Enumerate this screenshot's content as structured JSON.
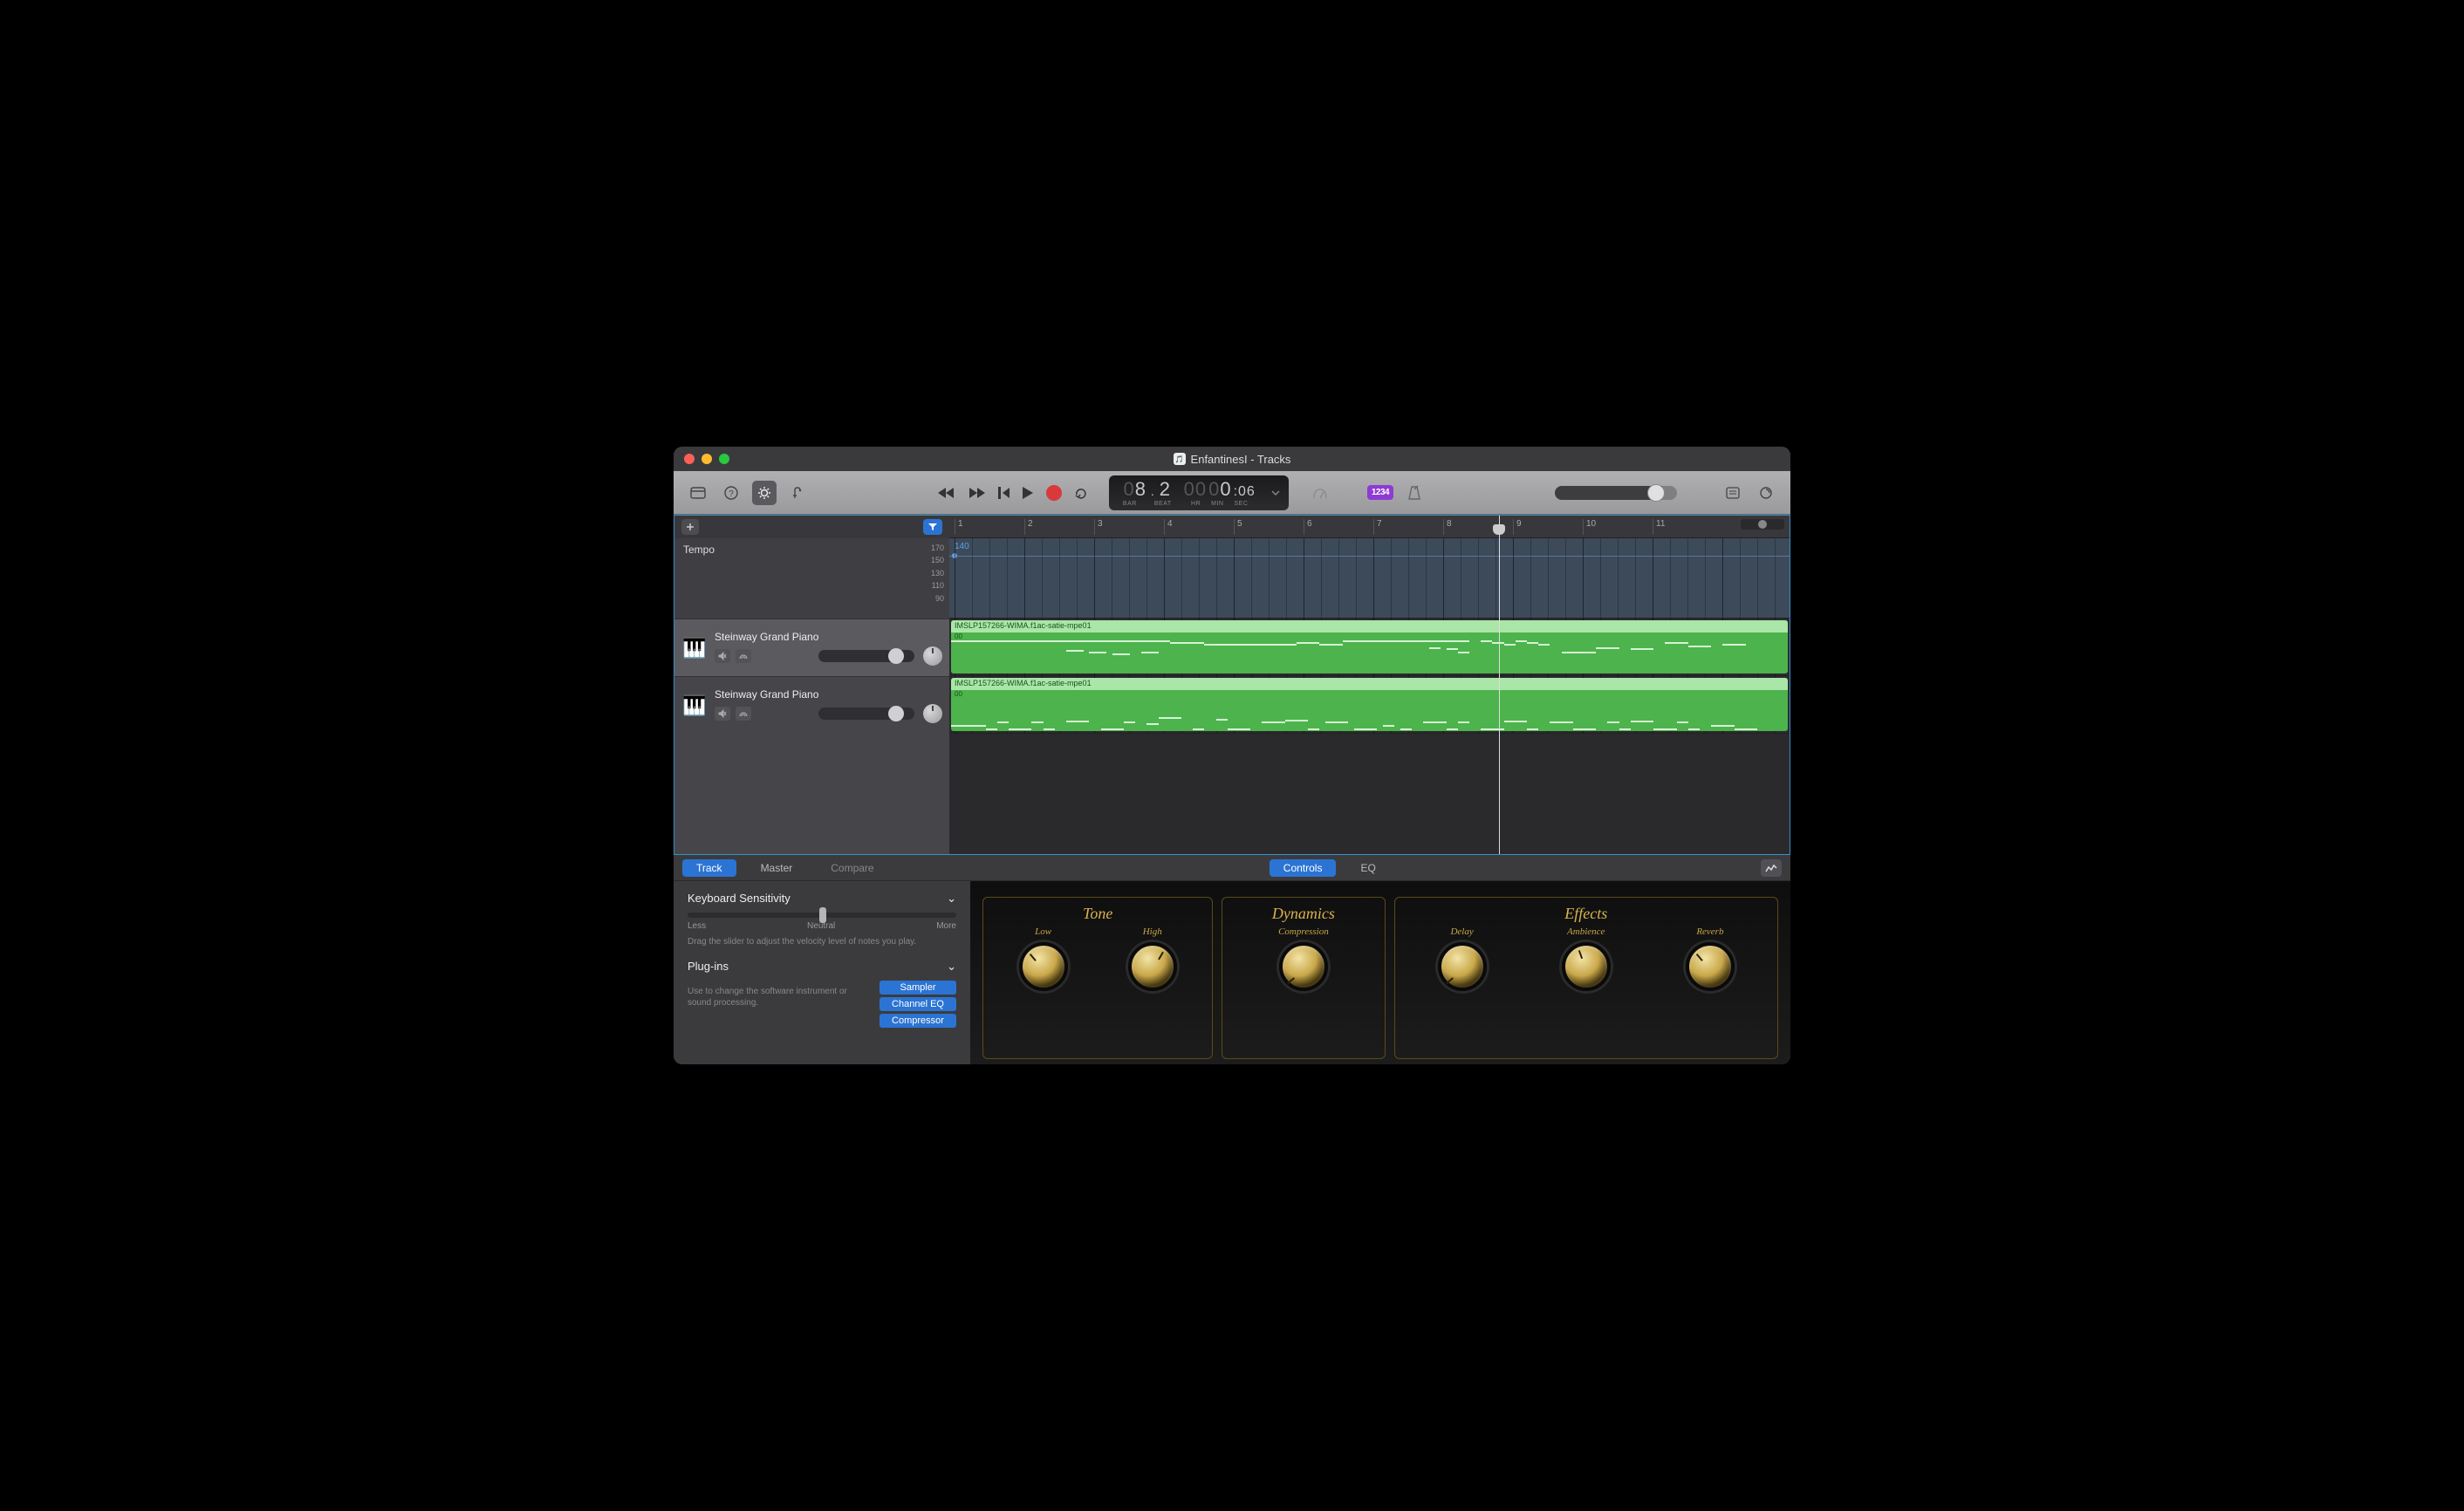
{
  "window": {
    "title": "EnfantinesI - Tracks"
  },
  "toolbar": {
    "count_in_badge": "1234"
  },
  "lcd": {
    "bar": "08.2",
    "bar_label": "BAR",
    "beat_label": "BEAT",
    "hr": "00",
    "min": "00",
    "sec": ":06",
    "hr_label": "HR",
    "min_label": "MIN",
    "sec_label": "SEC"
  },
  "ruler": {
    "bars": [
      1,
      2,
      3,
      4,
      5,
      6,
      7,
      8,
      9,
      10,
      11
    ],
    "playhead_bar": 8.8
  },
  "sidebar": {
    "tempo_label": "Tempo",
    "tempo_scale": [
      "170",
      "150",
      "130",
      "110",
      "90"
    ],
    "tempo_value": "140"
  },
  "tracks": [
    {
      "name": "Steinway Grand Piano",
      "selected": true
    },
    {
      "name": "Steinway Grand Piano",
      "selected": false
    }
  ],
  "regions": [
    {
      "title": "IMSLP157266-WIMA.f1ac-satie-mpe01",
      "sub": "00"
    },
    {
      "title": "IMSLP157266-WIMA.f1ac-satie-mpe01",
      "sub": "00"
    }
  ],
  "panel": {
    "tabs_left": {
      "track": "Track",
      "master": "Master",
      "compare": "Compare"
    },
    "tabs_center": {
      "controls": "Controls",
      "eq": "EQ"
    },
    "keyboard_sensitivity": {
      "title": "Keyboard Sensitivity",
      "less": "Less",
      "neutral": "Neutral",
      "more": "More",
      "help": "Drag the slider to adjust the velocity level of notes you play."
    },
    "plugins": {
      "title": "Plug-ins",
      "help": "Use to change the software instrument or sound processing.",
      "items": [
        "Sampler",
        "Channel EQ",
        "Compressor"
      ]
    }
  },
  "instrument": {
    "tone": {
      "title": "Tone",
      "labels": [
        "Low",
        "High"
      ]
    },
    "dynamics": {
      "title": "Dynamics",
      "labels": [
        "Compression"
      ]
    },
    "effects": {
      "title": "Effects",
      "labels": [
        "Delay",
        "Ambience",
        "Reverb"
      ]
    }
  },
  "midi_notes_a": [
    [
      0,
      74,
      10
    ],
    [
      6,
      74,
      32
    ],
    [
      38,
      72,
      6
    ],
    [
      20,
      62,
      3
    ],
    [
      24,
      60,
      3
    ],
    [
      28,
      58,
      3
    ],
    [
      33,
      60,
      3
    ],
    [
      44,
      70,
      16
    ],
    [
      60,
      72,
      4
    ],
    [
      64,
      70,
      4
    ],
    [
      68,
      74,
      22
    ],
    [
      83,
      66,
      2
    ],
    [
      86,
      64,
      2
    ],
    [
      88,
      60,
      2
    ],
    [
      92,
      74,
      2
    ],
    [
      94,
      72,
      2
    ],
    [
      96,
      70,
      2
    ],
    [
      98,
      74,
      2
    ],
    [
      100,
      72,
      2
    ],
    [
      102,
      70,
      2
    ],
    [
      106,
      60,
      6
    ],
    [
      112,
      66,
      4
    ],
    [
      118,
      64,
      4
    ],
    [
      124,
      72,
      4
    ],
    [
      128,
      68,
      4
    ],
    [
      134,
      70,
      4
    ]
  ],
  "midi_notes_b": [
    [
      0,
      40,
      6
    ],
    [
      6,
      36,
      2
    ],
    [
      8,
      44,
      2
    ],
    [
      10,
      36,
      4
    ],
    [
      14,
      44,
      2
    ],
    [
      16,
      36,
      2
    ],
    [
      20,
      46,
      4
    ],
    [
      26,
      36,
      4
    ],
    [
      30,
      44,
      2
    ],
    [
      34,
      42,
      2
    ],
    [
      36,
      50,
      4
    ],
    [
      42,
      36,
      2
    ],
    [
      46,
      48,
      2
    ],
    [
      48,
      36,
      4
    ],
    [
      54,
      44,
      4
    ],
    [
      58,
      47,
      4
    ],
    [
      62,
      36,
      2
    ],
    [
      65,
      44,
      4
    ],
    [
      70,
      36,
      4
    ],
    [
      75,
      40,
      2
    ],
    [
      78,
      36,
      2
    ],
    [
      82,
      44,
      4
    ],
    [
      86,
      36,
      2
    ],
    [
      88,
      44,
      2
    ],
    [
      92,
      36,
      4
    ],
    [
      96,
      46,
      4
    ],
    [
      100,
      36,
      2
    ],
    [
      104,
      44,
      4
    ],
    [
      108,
      36,
      4
    ],
    [
      114,
      44,
      2
    ],
    [
      116,
      36,
      2
    ],
    [
      118,
      46,
      4
    ],
    [
      122,
      36,
      4
    ],
    [
      126,
      44,
      2
    ],
    [
      128,
      36,
      2
    ],
    [
      132,
      40,
      4
    ],
    [
      136,
      36,
      4
    ]
  ]
}
